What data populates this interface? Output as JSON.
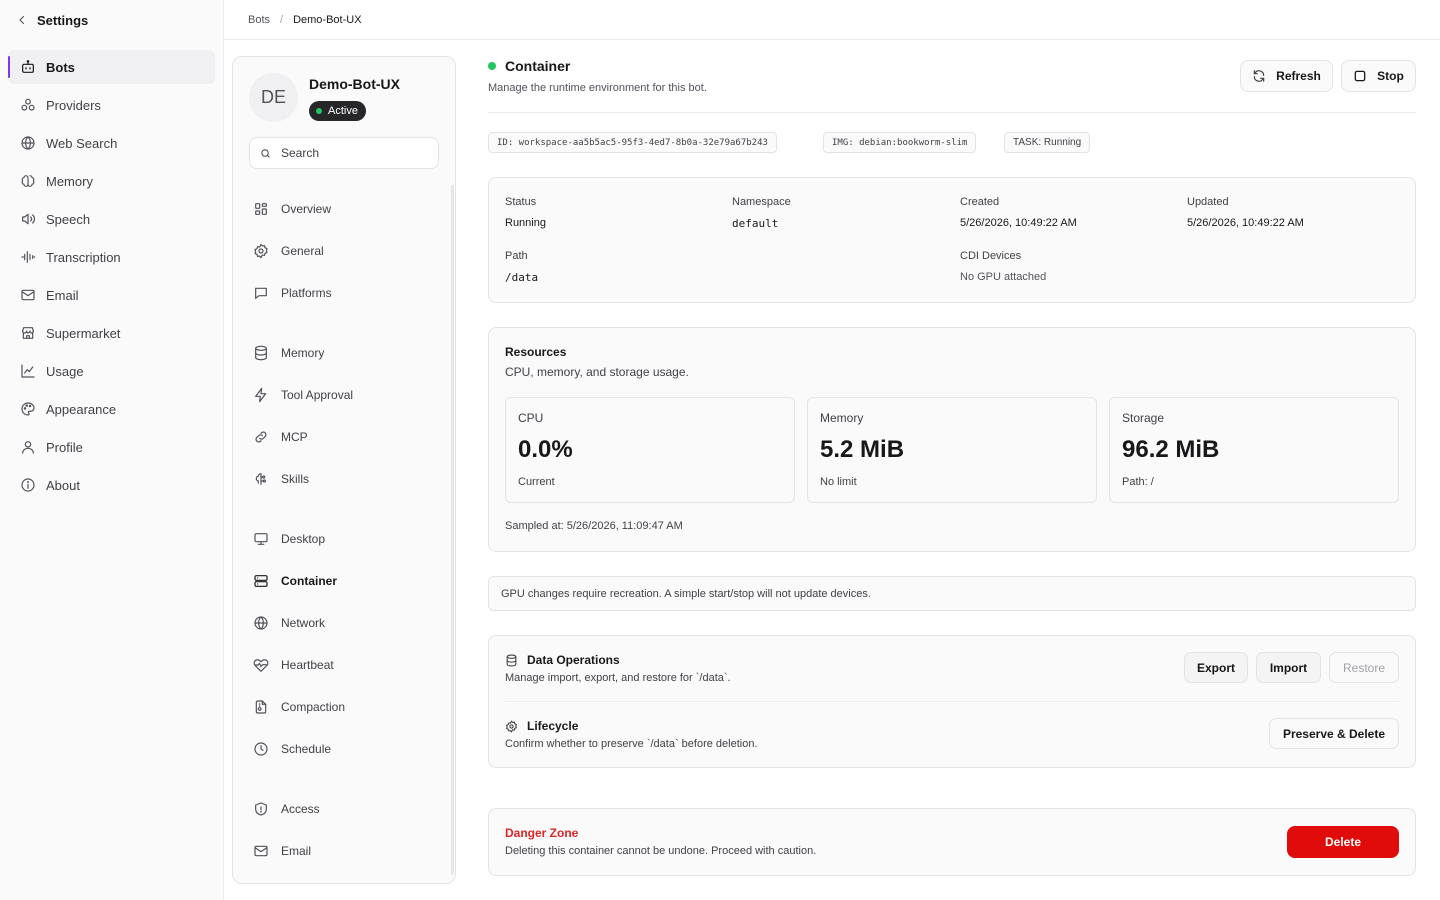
{
  "settings": {
    "back_label": "Settings",
    "nav": [
      {
        "label": "Bots",
        "icon": "bot-icon",
        "active": true
      },
      {
        "label": "Providers",
        "icon": "providers-icon"
      },
      {
        "label": "Web Search",
        "icon": "globe-icon"
      },
      {
        "label": "Memory",
        "icon": "brain-icon"
      },
      {
        "label": "Speech",
        "icon": "speaker-icon"
      },
      {
        "label": "Transcription",
        "icon": "audio-waveform-icon"
      },
      {
        "label": "Email",
        "icon": "mail-icon"
      },
      {
        "label": "Supermarket",
        "icon": "store-icon"
      },
      {
        "label": "Usage",
        "icon": "chart-line-icon"
      },
      {
        "label": "Appearance",
        "icon": "palette-icon"
      },
      {
        "label": "Profile",
        "icon": "user-icon"
      },
      {
        "label": "About",
        "icon": "info-icon"
      }
    ]
  },
  "breadcrumb": {
    "root": "Bots",
    "current": "Demo-Bot-UX"
  },
  "bot": {
    "initials": "DE",
    "name": "Demo-Bot-UX",
    "status": "Active",
    "search_placeholder": "Search",
    "nav_groups": [
      [
        {
          "label": "Overview",
          "icon": "grid-icon"
        },
        {
          "label": "General",
          "icon": "gear-icon"
        },
        {
          "label": "Platforms",
          "icon": "chat-bubble-icon"
        }
      ],
      [
        {
          "label": "Memory",
          "icon": "database-icon"
        },
        {
          "label": "Tool Approval",
          "icon": "bolt-icon"
        },
        {
          "label": "MCP",
          "icon": "link-icon"
        },
        {
          "label": "Skills",
          "icon": "skills-icon"
        }
      ],
      [
        {
          "label": "Desktop",
          "icon": "monitor-icon"
        },
        {
          "label": "Container",
          "icon": "container-icon",
          "active": true
        },
        {
          "label": "Network",
          "icon": "globe-icon"
        },
        {
          "label": "Heartbeat",
          "icon": "heartbeat-icon"
        },
        {
          "label": "Compaction",
          "icon": "file-archive-icon"
        },
        {
          "label": "Schedule",
          "icon": "clock-icon"
        }
      ],
      [
        {
          "label": "Access",
          "icon": "shield-icon"
        },
        {
          "label": "Email",
          "icon": "mail-icon"
        }
      ]
    ]
  },
  "container": {
    "title": "Container",
    "subtitle": "Manage the runtime environment for this bot.",
    "refresh_label": "Refresh",
    "stop_label": "Stop",
    "chips": {
      "id": "ID: workspace-aa5b5ac5-95f3-4ed7-8b0a-32e79a67b243",
      "img": "IMG: debian:bookworm-slim",
      "task": "TASK: Running"
    },
    "info": {
      "status_label": "Status",
      "status_value": "Running",
      "namespace_label": "Namespace",
      "namespace_value": "default",
      "created_label": "Created",
      "created_value": "5/26/2026, 10:49:22 AM",
      "updated_label": "Updated",
      "updated_value": "5/26/2026, 10:49:22 AM",
      "path_label": "Path",
      "path_value": "/data",
      "cdi_label": "CDI Devices",
      "cdi_value": "No GPU attached"
    },
    "resources": {
      "title": "Resources",
      "subtitle": "CPU, memory, and storage usage.",
      "cpu": {
        "label": "CPU",
        "value": "0.0%",
        "sub": "Current"
      },
      "memory": {
        "label": "Memory",
        "value": "5.2 MiB",
        "sub": "No limit"
      },
      "storage": {
        "label": "Storage",
        "value": "96.2 MiB",
        "sub": "Path: /"
      },
      "sampled": "Sampled at: 5/26/2026, 11:09:47 AM"
    },
    "gpu_note": "GPU changes require recreation. A simple start/stop will not update devices.",
    "data_ops": {
      "title": "Data Operations",
      "subtitle": "Manage import, export, and restore for `/data`.",
      "export_label": "Export",
      "import_label": "Import",
      "restore_label": "Restore"
    },
    "lifecycle": {
      "title": "Lifecycle",
      "subtitle": "Confirm whether to preserve `/data` before deletion.",
      "button_label": "Preserve & Delete"
    },
    "danger": {
      "title": "Danger Zone",
      "subtitle": "Deleting this container cannot be undone. Proceed with caution.",
      "delete_label": "Delete"
    }
  },
  "colors": {
    "accent": "#7c3aed",
    "success": "#22c55e",
    "danger": "#e00b0b",
    "danger_text": "#dc2626"
  }
}
